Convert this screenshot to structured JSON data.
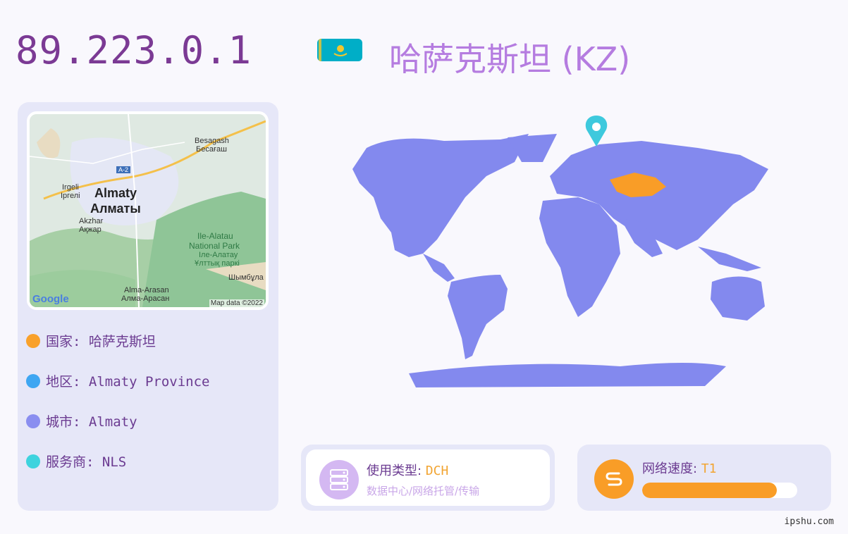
{
  "header": {
    "ip": "89.223.0.1",
    "country_title": "哈萨克斯坦 (KZ)"
  },
  "map": {
    "labels": {
      "besagash": "Besagash",
      "besagash_cyr": "Бесағаш",
      "road": "A-2",
      "irgeli": "Irgeli",
      "irgeli_cyr": "Іргелі",
      "almaty": "Almaty",
      "almaty_cyr": "Алматы",
      "akzhar": "Akzhar",
      "akzhar_cyr": "Ақжар",
      "park1": "Ile-Alatau",
      "park2": "National Park",
      "park3": "Іле-Алатау",
      "park4": "Ұлттық паркі",
      "shymbulak": "Шымбұла",
      "alma_arasan": "Alma-Arasan",
      "alma_arasan_cyr": "Алма-Арасан",
      "google": "Google",
      "map_data": "Map data ©2022"
    }
  },
  "info": {
    "country_label": "国家: 哈萨克斯坦",
    "region_label": "地区: Almaty Province",
    "city_label": "城市: Almaty",
    "isp_label": "服务商: NLS"
  },
  "usage": {
    "label": "使用类型: ",
    "value": "DCH",
    "description": "数据中心/网络托管/传输"
  },
  "speed": {
    "label": "网络速度: ",
    "value": "T1",
    "level_percent": 87
  },
  "watermark": "ipshu.com",
  "colors": {
    "country_dot": "#f9a12b",
    "region_dot": "#3ea6f2",
    "city_dot": "#8a8ef0",
    "isp_dot": "#3ed3de",
    "world_land": "#8389ee",
    "highlight": "#f99d27",
    "pin": "#3ec9dd"
  },
  "icons": {
    "usage": "server-icon",
    "speed": "speed-icon",
    "pin": "location-pin-icon"
  }
}
